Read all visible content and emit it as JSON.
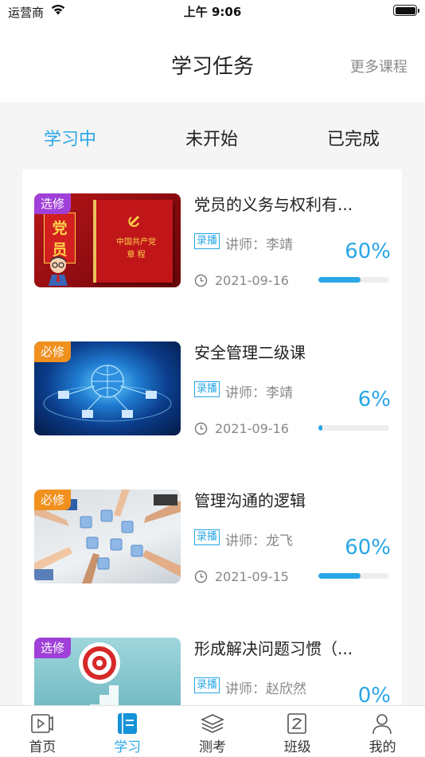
{
  "status_bar": {
    "carrier": "运营商",
    "time": "上午 9:06"
  },
  "header": {
    "title": "学习任务",
    "more_label": "更多课程"
  },
  "tabs": [
    {
      "label": "学习中",
      "active": true
    },
    {
      "label": "未开始",
      "active": false
    },
    {
      "label": "已完成",
      "active": false
    }
  ],
  "courses": [
    {
      "badge": "选修",
      "badge_type": "elective",
      "title": "党员的义务与权利有...",
      "type_tag": "录播",
      "teacher": "讲师：李靖",
      "percent": "60%",
      "progress": 0.6,
      "date": "2021-09-16",
      "thumb_alt": "党员 中国共产党章程"
    },
    {
      "badge": "必修",
      "badge_type": "required",
      "title": "安全管理二级课",
      "type_tag": "录播",
      "teacher": "讲师：李靖",
      "percent": "6%",
      "progress": 0.06,
      "date": "2021-09-16"
    },
    {
      "badge": "必修",
      "badge_type": "required",
      "title": "管理沟通的逻辑",
      "type_tag": "录播",
      "teacher": "讲师：龙飞",
      "percent": "60%",
      "progress": 0.6,
      "date": "2021-09-15"
    },
    {
      "badge": "选修",
      "badge_type": "elective",
      "title": "形成解决问题习惯（...",
      "type_tag": "录播",
      "teacher": "讲师：赵欣然",
      "percent": "0%",
      "progress": 0,
      "date": ""
    }
  ],
  "thumb1_text": {
    "big1": "党",
    "big2": "员",
    "book_title": "中国共产党",
    "book_sub": "章  程"
  },
  "tabbar": [
    {
      "label": "首页",
      "icon": "video-icon",
      "active": false
    },
    {
      "label": "学习",
      "icon": "study-icon",
      "active": true
    },
    {
      "label": "测考",
      "icon": "layers-icon",
      "active": false
    },
    {
      "label": "班级",
      "icon": "class-icon",
      "active": false
    },
    {
      "label": "我的",
      "icon": "user-icon",
      "active": false
    }
  ],
  "colors": {
    "accent": "#29a6e6",
    "elective": "#a040d8",
    "required": "#f0901e"
  }
}
